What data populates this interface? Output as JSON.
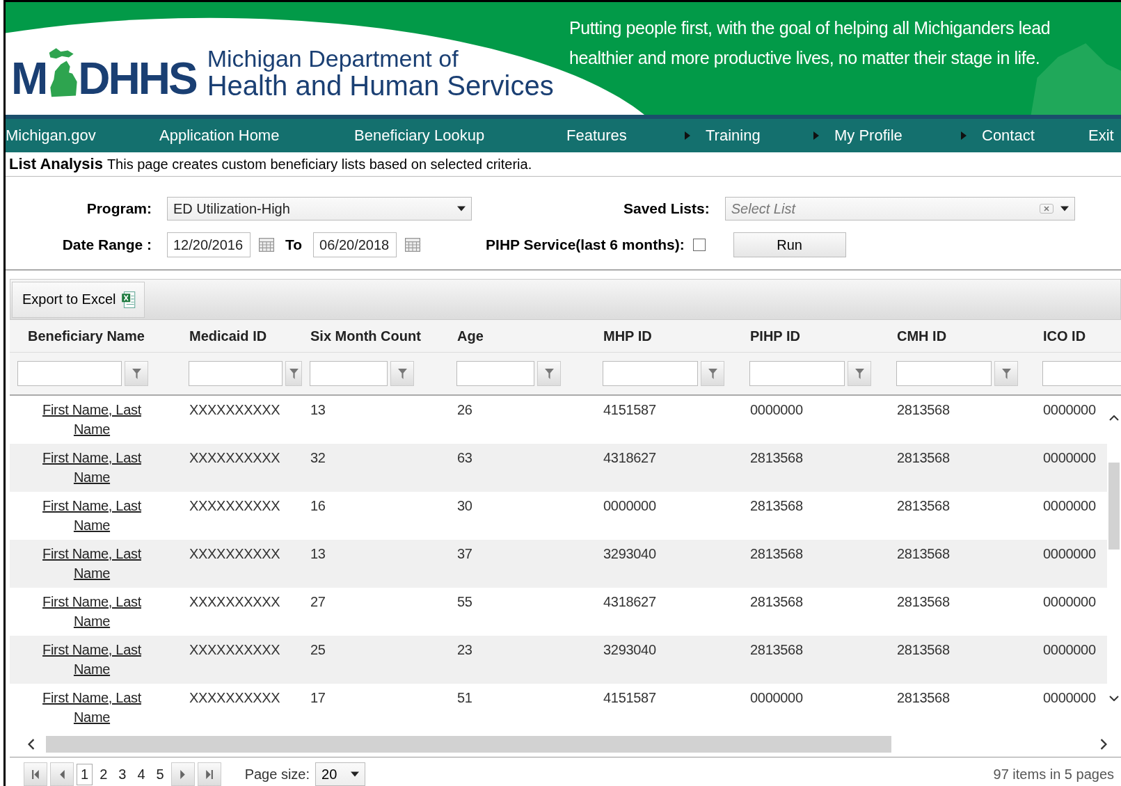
{
  "header": {
    "logo_left": "M",
    "logo_right": "DHHS",
    "org_line_1": "Michigan Department of",
    "org_line_2": "Health and Human Services",
    "tagline_1": "Putting people first, with the goal of helping all Michiganders lead",
    "tagline_2": "healthier and more productive lives, no matter their stage in life."
  },
  "nav": [
    {
      "label": "Michigan.gov",
      "submenu": false
    },
    {
      "label": "Application Home",
      "submenu": false
    },
    {
      "label": "Beneficiary Lookup",
      "submenu": false
    },
    {
      "label": "Features",
      "submenu": true
    },
    {
      "label": "Training",
      "submenu": true
    },
    {
      "label": "My Profile",
      "submenu": true
    },
    {
      "label": "Contact",
      "submenu": false
    },
    {
      "label": "Exit",
      "submenu": false
    }
  ],
  "page_title": "List Analysis",
  "page_description": "This page creates custom beneficiary lists based on selected criteria.",
  "form": {
    "program_label": "Program:",
    "program_value": "ED Utilization-High",
    "saved_lists_label": "Saved Lists:",
    "saved_lists_placeholder": "Select List",
    "date_range_label": "Date Range :",
    "date_from": "12/20/2016",
    "to_label": "To",
    "date_to": "06/20/2018",
    "pihp_label": "PIHP Service(last 6 months):",
    "pihp_checked": false,
    "run_button": "Run"
  },
  "toolbar": {
    "export_button": "Export to Excel"
  },
  "table": {
    "columns": [
      "Beneficiary Name",
      "Medicaid ID",
      "Six Month Count",
      "Age",
      "MHP ID",
      "PIHP ID",
      "CMH ID",
      "ICO ID"
    ],
    "rows": [
      [
        "First Name, Last Name",
        "XXXXXXXXXX",
        "13",
        "26",
        "4151587",
        "0000000",
        "2813568",
        "0000000"
      ],
      [
        "First Name, Last Name",
        "XXXXXXXXXX",
        "32",
        "63",
        "4318627",
        "2813568",
        "2813568",
        "0000000"
      ],
      [
        "First Name, Last Name",
        "XXXXXXXXXX",
        "16",
        "30",
        "0000000",
        "2813568",
        "2813568",
        "0000000"
      ],
      [
        "First Name, Last Name",
        "XXXXXXXXXX",
        "13",
        "37",
        "3293040",
        "2813568",
        "2813568",
        "0000000"
      ],
      [
        "First Name, Last Name",
        "XXXXXXXXXX",
        "27",
        "55",
        "4318627",
        "2813568",
        "2813568",
        "0000000"
      ],
      [
        "First Name, Last Name",
        "XXXXXXXXXX",
        "25",
        "23",
        "3293040",
        "2813568",
        "2813568",
        "0000000"
      ],
      [
        "First Name, Last Name",
        "XXXXXXXXXX",
        "17",
        "51",
        "4151587",
        "0000000",
        "2813568",
        "0000000"
      ]
    ]
  },
  "pager": {
    "pages": [
      {
        "label": "1",
        "selected": true
      },
      {
        "label": "2",
        "selected": false
      },
      {
        "label": "3",
        "selected": false
      },
      {
        "label": "4",
        "selected": false
      },
      {
        "label": "5",
        "selected": false
      }
    ],
    "page_size_label": "Page size:",
    "page_size": "20",
    "summary": "97 items in 5 pages"
  }
}
